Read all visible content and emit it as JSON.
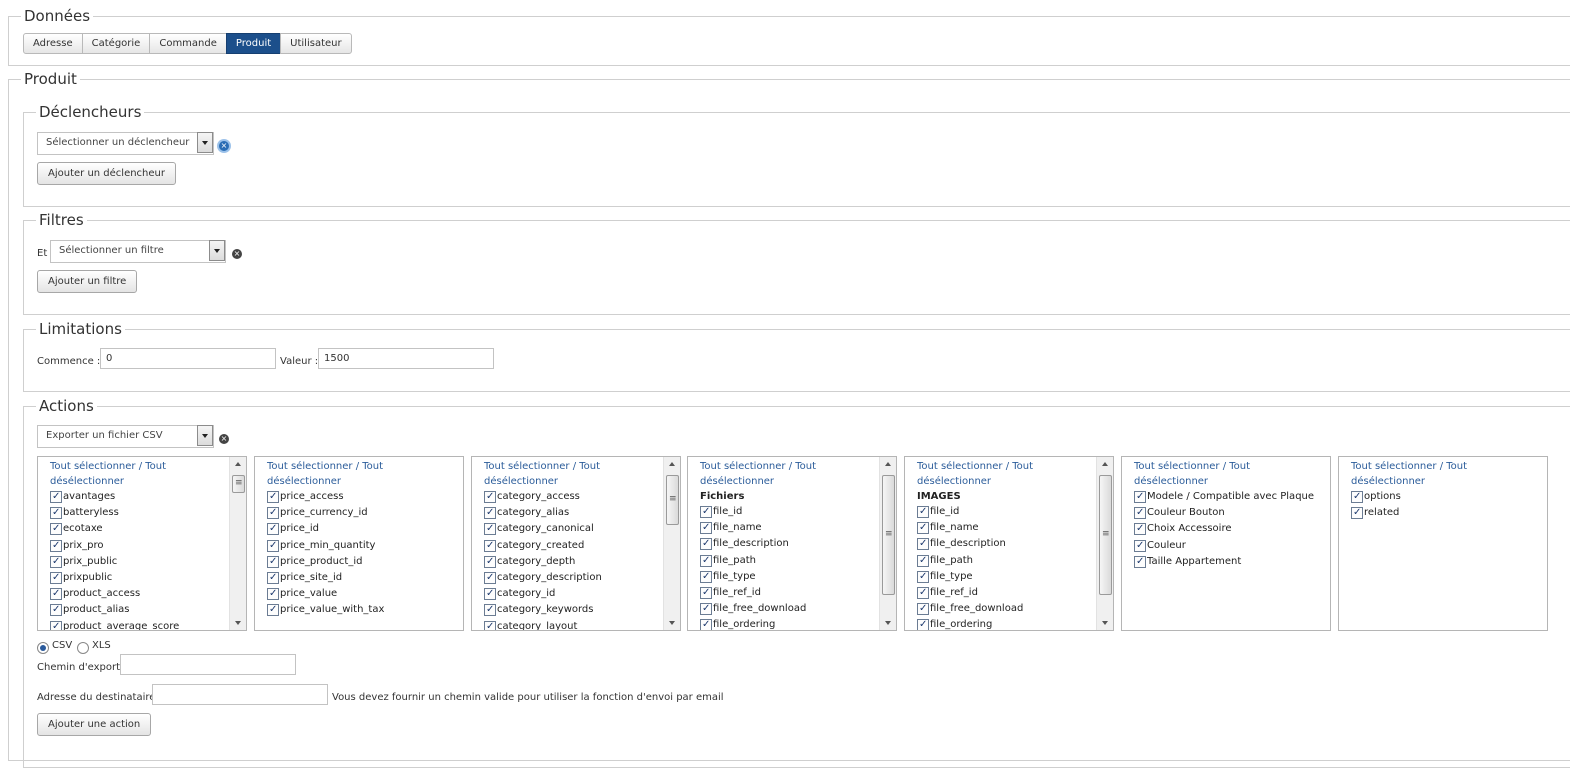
{
  "donnees": {
    "legend": "Données",
    "tabs": [
      {
        "label": "Adresse",
        "active": false
      },
      {
        "label": "Catégorie",
        "active": false
      },
      {
        "label": "Commande",
        "active": false
      },
      {
        "label": "Produit",
        "active": true
      },
      {
        "label": "Utilisateur",
        "active": false
      }
    ]
  },
  "produit": {
    "legend": "Produit",
    "declencheurs": {
      "legend": "Déclencheurs",
      "select_value": "Sélectionner un déclencheur",
      "add_button": "Ajouter un déclencheur"
    },
    "filtres": {
      "legend": "Filtres",
      "prefix": "Et",
      "select_value": "Sélectionner un filtre",
      "add_button": "Ajouter un filtre"
    },
    "limitations": {
      "legend": "Limitations",
      "start_label": "Commence :",
      "start_value": "0",
      "value_label": "Valeur :",
      "value_value": "1500"
    },
    "actions": {
      "legend": "Actions",
      "select_value": "Exporter un fichier CSV",
      "lists": [
        {
          "head": "Tout sélectionner / Tout désélectionner",
          "group": "",
          "items": [
            "avantages",
            "batteryless",
            "ecotaxe",
            "prix_pro",
            "prix_public",
            "prixpublic",
            "product_access",
            "product_alias",
            "product_average_score"
          ]
        },
        {
          "head": "Tout sélectionner / Tout désélectionner",
          "group": "",
          "items": [
            "price_access",
            "price_currency_id",
            "price_id",
            "price_min_quantity",
            "price_product_id",
            "price_site_id",
            "price_value",
            "price_value_with_tax"
          ]
        },
        {
          "head": "Tout sélectionner / Tout désélectionner",
          "group": "",
          "items": [
            "category_access",
            "category_alias",
            "category_canonical",
            "category_created",
            "category_depth",
            "category_description",
            "category_id",
            "category_keywords",
            "category_layout"
          ]
        },
        {
          "head": "Tout sélectionner / Tout désélectionner",
          "group": "Fichiers",
          "items": [
            "file_id",
            "file_name",
            "file_description",
            "file_path",
            "file_type",
            "file_ref_id",
            "file_free_download",
            "file_ordering"
          ]
        },
        {
          "head": "Tout sélectionner / Tout désélectionner",
          "group": "IMAGES",
          "items": [
            "file_id",
            "file_name",
            "file_description",
            "file_path",
            "file_type",
            "file_ref_id",
            "file_free_download",
            "file_ordering"
          ]
        },
        {
          "head": "Tout sélectionner / Tout désélectionner",
          "group": "",
          "items": [
            "Modele / Compatible avec Plaque",
            "Couleur Bouton",
            "Choix Accessoire",
            "Couleur",
            "Taille Appartement"
          ]
        },
        {
          "head": "Tout sélectionner / Tout désélectionner",
          "group": "",
          "items": [
            "options",
            "related"
          ]
        }
      ],
      "format_csv": "CSV",
      "format_xls": "XLS",
      "export_path_label": "Chemin d'export:",
      "export_path_value": "",
      "recipient_label": "Adresse du destinataire:",
      "recipient_value": "",
      "recipient_hint": "Vous devez fournir un chemin valide pour utiliser la fonction d'envoi par email",
      "add_button": "Ajouter une action"
    }
  },
  "colors": {
    "active_tab": "#1c4f8b",
    "link": "#2b5c9a",
    "border": "#cfcfcf"
  }
}
